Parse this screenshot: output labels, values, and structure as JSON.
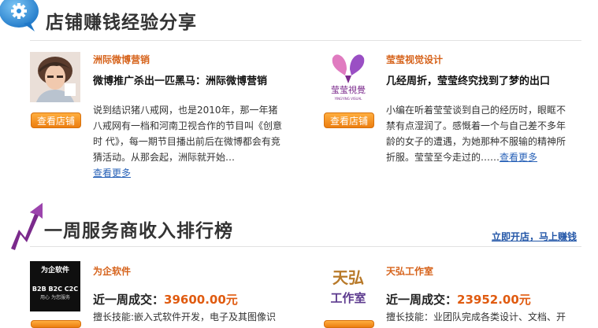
{
  "section_experience": {
    "title": "店铺赚钱经验分享",
    "cards": [
      {
        "shop_name": "洲际微博营销",
        "headline": "微博推广杀出一匹黑马：洲际微博营销",
        "description": "说到结识猪八戒网，也是2010年，那一年猪八戒网有一档和河南卫视合作的节目叫《创意时 代》，每一期节目播出前后在微博都会有竞猜活动。从那会起，洲际就开始…",
        "more_label": "查看更多",
        "button_label": "查看店铺"
      },
      {
        "shop_name": "莹莹视觉设计",
        "headline": "几经周折，莹莹终究找到了梦的出口",
        "description": "小编在听着莹莹谈到自己的经历时，眼眶不禁有点湿润了。感慨着一个与自己差不多年龄的女子的遭遇，为她那种不服输的精神所折服。莹莹至今走过的……",
        "more_label": "查看更多",
        "button_label": "查看店铺",
        "logo_text": "莹莹視覺",
        "logo_sub": "YINGYING VISUAL"
      }
    ]
  },
  "section_ranking": {
    "title": "一周服务商收入排行榜",
    "link_label": "立即开店，马上赚钱",
    "providers": [
      {
        "name": "为企软件",
        "deal_label": "近一周成交：",
        "deal_amount": "39600.00元",
        "skill": "擅长技能:嵌入式软件开发，电子及其图像识",
        "logo_line1": "为企软件",
        "logo_line2": "B2B B2C C2C",
        "logo_line3": "用心 为您服务"
      },
      {
        "name": "天弘工作室",
        "deal_label": "近一周成交：",
        "deal_amount": "23952.00元",
        "skill": "擅长技能：业团队完成各类设计、文档、开",
        "logo_line1": "天弘",
        "logo_line2": "工作室"
      }
    ]
  },
  "colors": {
    "accent_orange": "#e05b10",
    "link_blue": "#2457a8",
    "brand_blue": "#2f8fdc",
    "purple": "#7b2a8c"
  }
}
